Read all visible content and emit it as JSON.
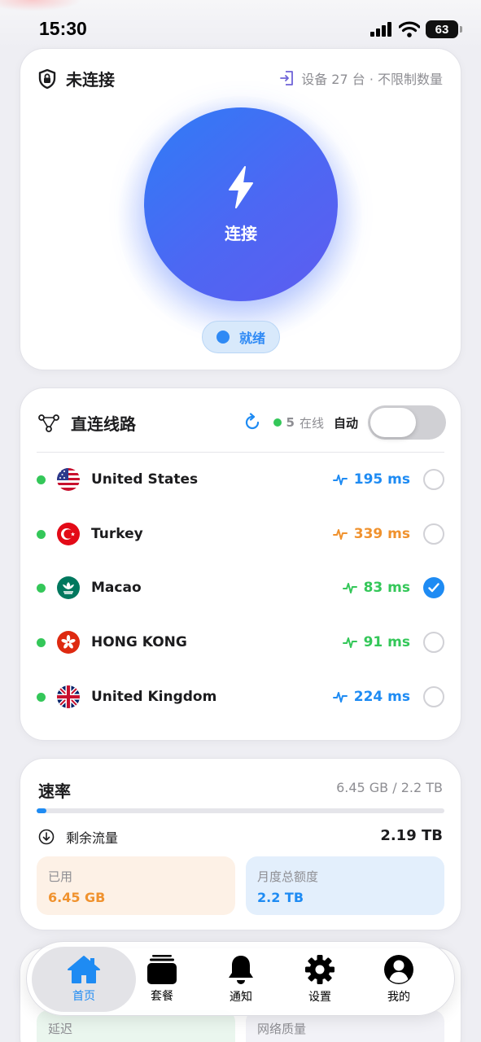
{
  "status_bar": {
    "time": "15:30",
    "battery": "63"
  },
  "connection": {
    "title": "未连接",
    "device_info": "设备 27 台 · 不限制数量",
    "button_label": "连接",
    "status": "就绪"
  },
  "lines": {
    "title": "直连线路",
    "online_count": "5",
    "online_label": "在线",
    "auto_label": "自动",
    "auto_enabled": false,
    "servers": [
      {
        "name": "United States",
        "latency": "195 ms",
        "color": "#1e8bf3",
        "selected": false,
        "flag": "us-flag-icon"
      },
      {
        "name": "Turkey",
        "latency": "339 ms",
        "color": "#f0922e",
        "selected": false,
        "flag": "tr-flag-icon"
      },
      {
        "name": "Macao",
        "latency": "83 ms",
        "color": "#34c759",
        "selected": true,
        "flag": "mo-flag-icon"
      },
      {
        "name": "HONG KONG",
        "latency": "91 ms",
        "color": "#34c759",
        "selected": false,
        "flag": "hk-flag-icon"
      },
      {
        "name": "United Kingdom",
        "latency": "224 ms",
        "color": "#1e8bf3",
        "selected": false,
        "flag": "gb-flag-icon"
      }
    ]
  },
  "traffic": {
    "title": "速率",
    "usage": "6.45 GB / 2.2 TB",
    "used_fraction": 0.003,
    "remaining_label": "剩余流量",
    "remaining_value": "2.19 TB",
    "used_label": "已用",
    "used_value": "6.45 GB",
    "total_label": "月度总额度",
    "total_value": "2.2 TB"
  },
  "bottom": {
    "latency_label": "延迟",
    "quality_label": "网络质量"
  },
  "tabs": [
    {
      "label": "首页",
      "icon": "home-icon",
      "active": true
    },
    {
      "label": "套餐",
      "icon": "plans-icon",
      "active": false
    },
    {
      "label": "通知",
      "icon": "bell-icon",
      "active": false
    },
    {
      "label": "设置",
      "icon": "gear-icon",
      "active": false
    },
    {
      "label": "我的",
      "icon": "profile-icon",
      "active": false
    }
  ],
  "colors": {
    "accent": "#1e8bf3",
    "online": "#34c759",
    "warning": "#f0922e"
  }
}
